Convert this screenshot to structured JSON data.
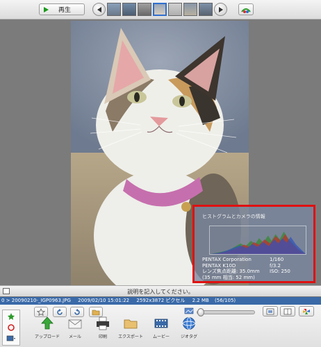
{
  "toolbar": {
    "play_label": "再生",
    "thumbnails": [
      "thumb-1",
      "thumb-2",
      "thumb-3",
      "thumb-4",
      "thumb-5",
      "thumb-6",
      "thumb-7"
    ],
    "selected_thumbnail_index": 3
  },
  "histogram": {
    "title": "ヒストグラムとカメラの情報",
    "rows": [
      [
        "PENTAX Corporation",
        "1/160"
      ],
      [
        "PENTAX K10D",
        "f/3.2"
      ],
      [
        "レンズ焦点距離: 35.0mm",
        "ISO: 250"
      ],
      [
        "(35 mm 相当: 52 mm)",
        ""
      ]
    ]
  },
  "caption": {
    "placeholder": "説明を記入してください。"
  },
  "infobar": {
    "path": "0 > 20090210-_IGP0963.JPG",
    "date": "2009/02/10 15:01:22",
    "dimensions": "2592x3872 ピクセル",
    "size": "2.2 MB",
    "position": "(56/105)"
  },
  "actions": [
    {
      "name": "upload-action",
      "label": "アップロード",
      "icon": "upload-icon"
    },
    {
      "name": "mail-action",
      "label": "メール",
      "icon": "mail-icon"
    },
    {
      "name": "print-action",
      "label": "印刷",
      "icon": "printer-icon"
    },
    {
      "name": "export-action",
      "label": "エクスポート",
      "icon": "folder-icon"
    },
    {
      "name": "movie-action",
      "label": "ムービー",
      "icon": "film-icon"
    },
    {
      "name": "geotag-action",
      "label": "ジオタグ",
      "icon": "globe-icon"
    }
  ],
  "zoom": {
    "level": 0.0
  },
  "colors": {
    "accent": "#3a6aa8",
    "highlight": "#e01010",
    "play": "#1a9a1a"
  }
}
